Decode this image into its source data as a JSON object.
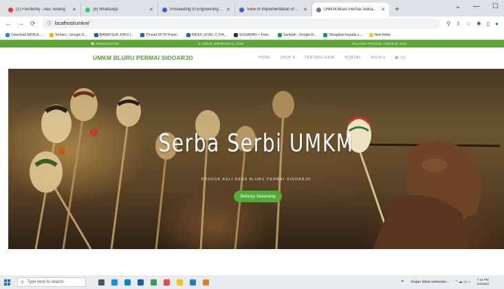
{
  "browser": {
    "tabs": [
      {
        "title": "(1) Fourtwnty - Aku Tenang",
        "color": "#e53935"
      },
      {
        "title": "(9) WhatsApp",
        "color": "#25d366"
      },
      {
        "title": "Proceeding of Engineering and Lif",
        "color": "#3b5bdb"
      },
      {
        "title": "View of Implementation of E-Gr",
        "color": "#3b5bdb"
      },
      {
        "title": "UMKM Bluru Permai Sidoarjo | V",
        "color": "#555555",
        "active": true
      }
    ],
    "new_tab": "+",
    "url": "localhost/umkm/",
    "bookmarks": [
      {
        "label": "Download MODUL...",
        "color": "#1e88e5"
      },
      {
        "label": "Terbaru - Google D...",
        "color": "#f4b400"
      },
      {
        "label": "BIAWA GUE JOKO I...",
        "color": "#1565c0"
      },
      {
        "label": "Thread SFTH Popul...",
        "color": "#1565c0"
      },
      {
        "label": "INDEX LEVEL 3 | KA...",
        "color": "#1565c0"
      },
      {
        "label": "SIGSAWIKI + Free...",
        "color": "#333333"
      },
      {
        "label": "Sampah - Google D...",
        "color": "#0f9d58"
      },
      {
        "label": "Dibagikan kepada s...",
        "color": "#0f9d58"
      },
      {
        "label": "New folder",
        "color": "#f4c430"
      }
    ]
  },
  "site": {
    "topbar": {
      "phone": "☎ 085604437102",
      "email": "✉ UMKM_BP5@GMAIL.COM",
      "promo": "BELANJA PRODUK UMKM DI SINI"
    },
    "brand": "UMKM BLURU PERMAI SIDOARJO",
    "menu": [
      "HOME",
      "SHOP ▾",
      "TENTANG KAMI",
      "KONTAK",
      "AKUN ▾",
      "▦ (0)"
    ],
    "hero": {
      "title": "Serba Serbi UMKM",
      "subtitle": "PRODUK ASLI DESA BLURU PERMAI SIDOARJO",
      "cta": "Belanja Sekarang"
    }
  },
  "taskbar": {
    "search_placeholder": "Type here to search",
    "weather": "Hujan lebat sebentar...",
    "time": "7:16 PM",
    "date": "2/4/2023"
  },
  "colors": {
    "brand_green": "#4ea02d",
    "topbar_green": "#5aa832",
    "button_green": "#55a83a"
  }
}
